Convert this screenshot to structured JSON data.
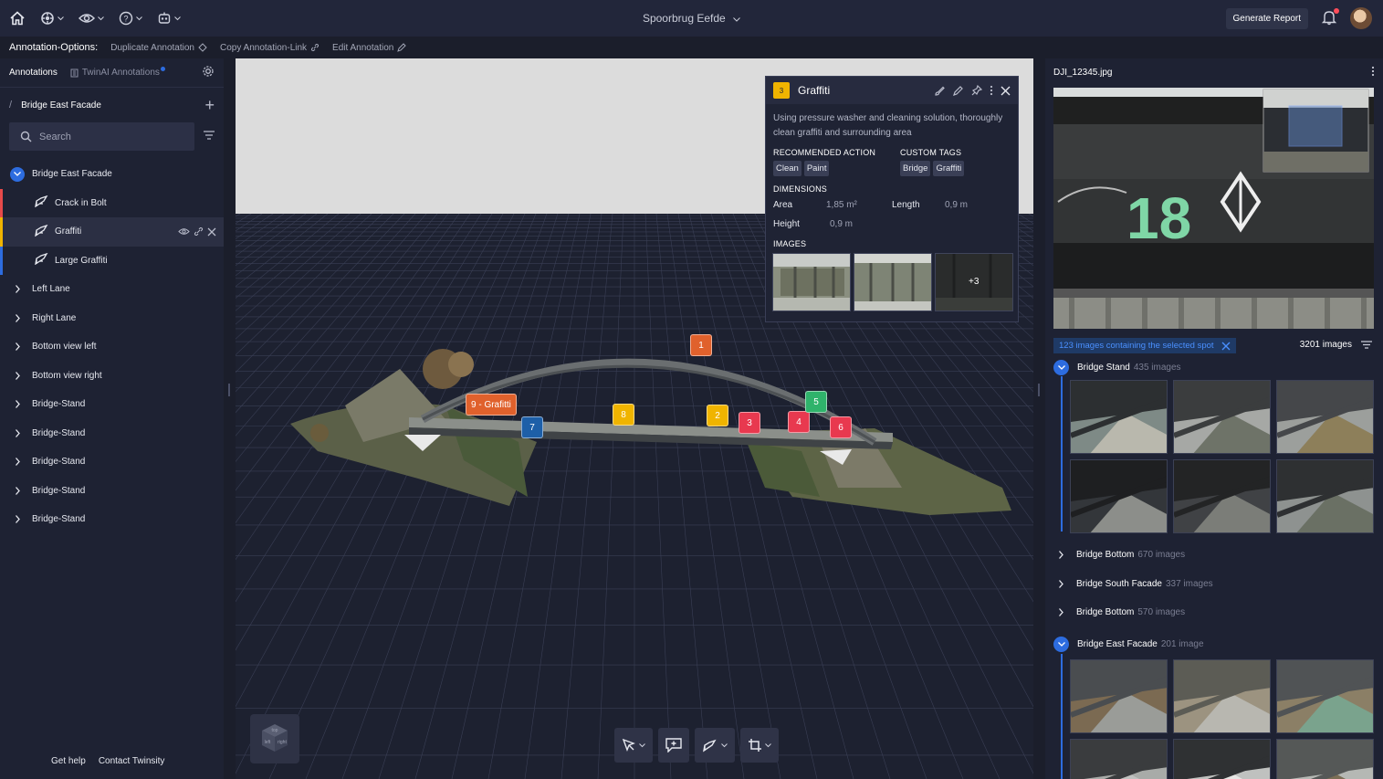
{
  "topbar": {
    "project_title": "Spoorbrug Eefde",
    "generate_report": "Generate Report",
    "notification_count": 1
  },
  "options": {
    "label": "Annotation-Options:",
    "duplicate": "Duplicate Annotation",
    "copy_link": "Copy Annotation-Link",
    "edit": "Edit Annotation"
  },
  "left": {
    "tab_annotations": "Annotations",
    "tab_twinai": "TwinAI Annotations",
    "current": "Bridge East Facade",
    "search_placeholder": "Search",
    "tree": [
      {
        "label": "Bridge East Facade",
        "open": true
      },
      {
        "label": "Crack in Bolt",
        "child": true,
        "color": "#e64a4a"
      },
      {
        "label": "Graffiti",
        "child": true,
        "color": "#f0b400",
        "selected": true
      },
      {
        "label": "Large Graffiti",
        "child": true,
        "color": "#2d6cdf"
      },
      {
        "label": "Left Lane"
      },
      {
        "label": "Right Lane"
      },
      {
        "label": "Bottom view left"
      },
      {
        "label": "Bottom view right"
      },
      {
        "label": "Bridge-Stand"
      },
      {
        "label": "Bridge-Stand"
      },
      {
        "label": "Bridge-Stand"
      },
      {
        "label": "Bridge-Stand"
      },
      {
        "label": "Bridge-Stand"
      }
    ],
    "get_help": "Get help",
    "contact": "Contact Twinsity"
  },
  "viewport": {
    "markers": [
      {
        "label": "1",
        "color": "#e0612c"
      },
      {
        "label": "9 - Grafitti",
        "color": "#e0612c"
      },
      {
        "label": "7",
        "color": "#1d5fa8"
      },
      {
        "label": "8",
        "color": "#f0b400"
      },
      {
        "label": "2",
        "color": "#f0b400"
      },
      {
        "label": "3",
        "color": "#e8394f"
      },
      {
        "label": "4",
        "color": "#e8394f"
      },
      {
        "label": "5",
        "color": "#2fb36b"
      },
      {
        "label": "6",
        "color": "#e8394f"
      }
    ],
    "cube_labels": [
      "top",
      "left",
      "right"
    ]
  },
  "card": {
    "badge": "3",
    "title": "Graffiti",
    "description": "Using pressure washer and cleaning solution, thoroughly clean graffiti and surrounding area",
    "recommended_label": "RECOMMENDED ACTION",
    "recommended": [
      "Clean",
      "Paint"
    ],
    "tags_label": "CUSTOM TAGS",
    "tags": [
      "Bridge",
      "Graffiti"
    ],
    "dimensions_label": "DIMENSIONS",
    "area_label": "Area",
    "area": "1,85 m²",
    "length_label": "Length",
    "length": "0,9 m",
    "height_label": "Height",
    "height": "0,9 m",
    "images_label": "IMAGES",
    "more_images": "+3"
  },
  "right": {
    "filename": "DJI_12345.jpg",
    "selection": "123 images containing the selected spot",
    "total": "3201 images",
    "groups": [
      {
        "name": "Bridge Stand",
        "count": "435 images",
        "open": true
      },
      {
        "name": "Bridge Bottom",
        "count": "670 images"
      },
      {
        "name": "Bridge South Facade",
        "count": "337 images"
      },
      {
        "name": "Bridge Bottom",
        "count": "570 images"
      },
      {
        "name": "Bridge East Facade",
        "count": "201 image",
        "open": true
      }
    ],
    "hero_graffiti_text": "18"
  }
}
